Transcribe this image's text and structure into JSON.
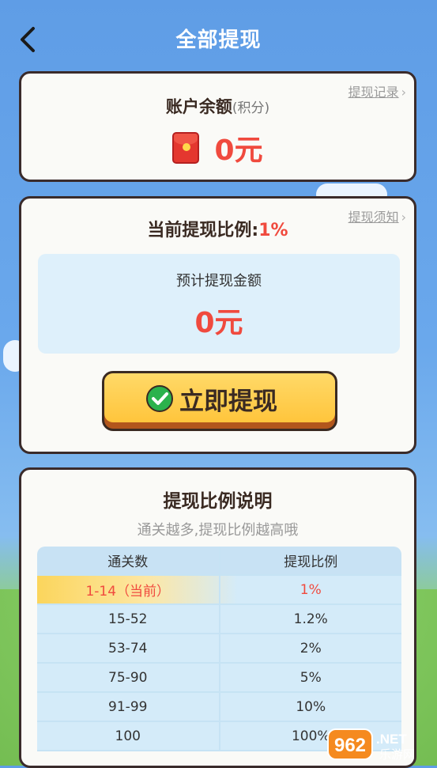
{
  "header": {
    "title": "全部提现"
  },
  "balance": {
    "label": "账户余额",
    "unit_note": "(积分)",
    "value": "0元",
    "records_link": "提现记录"
  },
  "withdraw": {
    "ratio_label": "当前提现比例:",
    "ratio_value": "1%",
    "notice_link": "提现须知",
    "estimate_label": "预计提现金额",
    "estimate_value": "0元",
    "button_label": "立即提现"
  },
  "ratio_table": {
    "title": "提现比例说明",
    "subtitle": "通关越多,提现比例越高哦",
    "columns": [
      "通关数",
      "提现比例"
    ],
    "rows": [
      {
        "levels": "1-14（当前）",
        "ratio": "1%"
      },
      {
        "levels": "15-52",
        "ratio": "1.2%"
      },
      {
        "levels": "53-74",
        "ratio": "2%"
      },
      {
        "levels": "75-90",
        "ratio": "5%"
      },
      {
        "levels": "91-99",
        "ratio": "10%"
      },
      {
        "levels": "100",
        "ratio": "100%"
      }
    ]
  },
  "watermark": {
    "brand": "962",
    "suffix": ".NET",
    "sub": "乐游网"
  },
  "colors": {
    "accent_red": "#f04a3e",
    "button_yellow": "#ffc53c",
    "border_dark": "#3a2b2b"
  }
}
